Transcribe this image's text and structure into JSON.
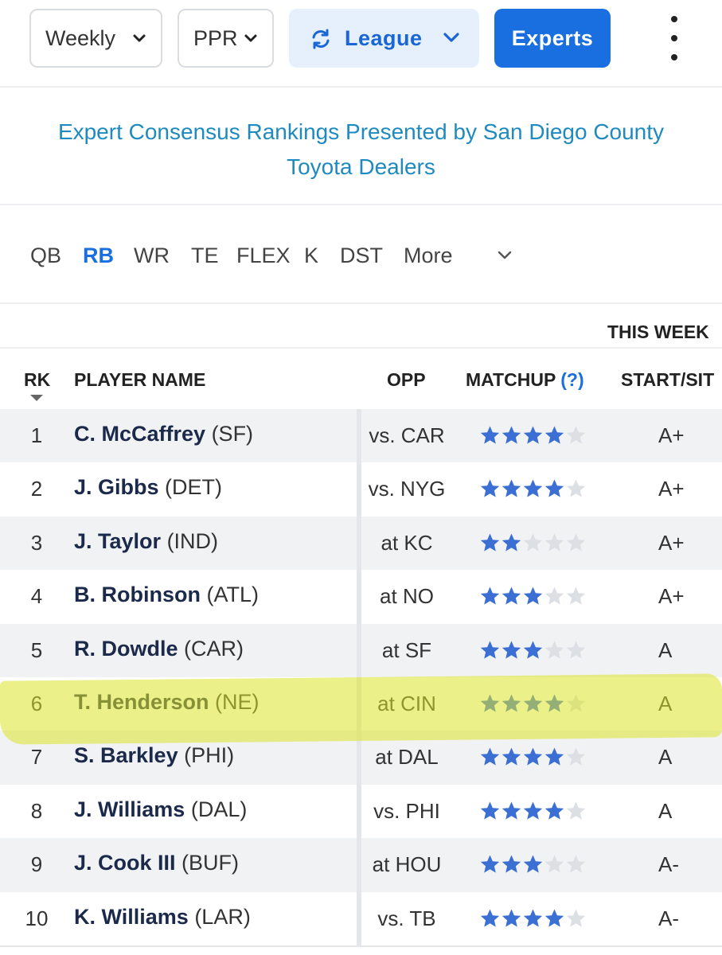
{
  "toolbar": {
    "period_select": "Weekly",
    "scoring_select": "PPR",
    "league_label": "League",
    "experts_label": "Experts"
  },
  "sponsor": {
    "line1": "Expert Consensus Rankings Presented by San Diego County",
    "line2": "Toyota Dealers"
  },
  "positions": {
    "tabs": [
      "QB",
      "RB",
      "WR",
      "TE",
      "FLEX",
      "K",
      "DST",
      "More"
    ],
    "active": "RB"
  },
  "table": {
    "group_header": "THIS WEEK",
    "headers": {
      "rk": "RK",
      "player": "PLAYER NAME",
      "opp": "OPP",
      "matchup": "MATCHUP",
      "matchup_help": "(?)",
      "start_sit": "START/SIT"
    },
    "rows": [
      {
        "rk": "1",
        "name": "C. McCaffrey",
        "team": "(SF)",
        "opp": "vs. CAR",
        "stars": 4,
        "grade": "A+"
      },
      {
        "rk": "2",
        "name": "J. Gibbs",
        "team": "(DET)",
        "opp": "vs. NYG",
        "stars": 4,
        "grade": "A+"
      },
      {
        "rk": "3",
        "name": "J. Taylor",
        "team": "(IND)",
        "opp": "at KC",
        "stars": 2,
        "grade": "A+"
      },
      {
        "rk": "4",
        "name": "B. Robinson",
        "team": "(ATL)",
        "opp": "at NO",
        "stars": 3,
        "grade": "A+"
      },
      {
        "rk": "5",
        "name": "R. Dowdle",
        "team": "(CAR)",
        "opp": "at SF",
        "stars": 3,
        "grade": "A"
      },
      {
        "rk": "6",
        "name": "T. Henderson",
        "team": "(NE)",
        "opp": "at CIN",
        "stars": 4,
        "grade": "A"
      },
      {
        "rk": "7",
        "name": "S. Barkley",
        "team": "(PHI)",
        "opp": "at DAL",
        "stars": 4,
        "grade": "A"
      },
      {
        "rk": "8",
        "name": "J. Williams",
        "team": "(DAL)",
        "opp": "vs. PHI",
        "stars": 4,
        "grade": "A"
      },
      {
        "rk": "9",
        "name": "J. Cook III",
        "team": "(BUF)",
        "opp": "at HOU",
        "stars": 3,
        "grade": "A-"
      },
      {
        "rk": "10",
        "name": "K. Williams",
        "team": "(LAR)",
        "opp": "vs. TB",
        "stars": 4,
        "grade": "A-"
      }
    ],
    "highlighted_rank": "6"
  },
  "colors": {
    "accent": "#1a6fe0",
    "sponsor_link": "#1f8ac0",
    "star_filled": "#3b6fd4",
    "star_empty": "#dcdfe4",
    "highlight": "#dce428",
    "player_name": "#1b2a4a"
  },
  "icons": {
    "dropdown": "chevron-down-icon",
    "league_sync": "sync-icon",
    "menu": "kebab-menu-icon",
    "rating": "star-icon",
    "sort": "sort-desc-icon"
  }
}
